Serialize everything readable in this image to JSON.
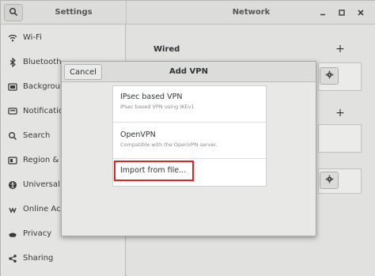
{
  "header": {
    "left_title": "Settings",
    "title": "Network",
    "search_icon": "search-icon",
    "window_buttons": [
      "minimize-icon",
      "maximize-icon",
      "close-icon"
    ]
  },
  "sidebar": {
    "items": [
      {
        "label": "Wi-Fi",
        "icon": "wifi-icon"
      },
      {
        "label": "Bluetooth",
        "icon": "bluetooth-icon"
      },
      {
        "label": "Background",
        "icon": "background-icon"
      },
      {
        "label": "Notifications",
        "icon": "notifications-icon"
      },
      {
        "label": "Search",
        "icon": "search-icon"
      },
      {
        "label": "Region & Language",
        "icon": "region-icon"
      },
      {
        "label": "Universal Access",
        "icon": "universal-access-icon"
      },
      {
        "label": "Online Accounts",
        "icon": "online-accounts-icon"
      },
      {
        "label": "Privacy",
        "icon": "privacy-icon"
      },
      {
        "label": "Sharing",
        "icon": "sharing-icon"
      }
    ]
  },
  "main": {
    "wired_label": "Wired",
    "add_symbol": "+"
  },
  "dialog": {
    "title": "Add VPN",
    "cancel_label": "Cancel",
    "options": [
      {
        "name": "IPsec based VPN",
        "description": "IPsec based VPN using IKEv1"
      },
      {
        "name": "OpenVPN",
        "description": "Compatible with the OpenVPN server."
      },
      {
        "name": "Import from file...",
        "description": ""
      }
    ],
    "highlight_color": "#e02424"
  }
}
